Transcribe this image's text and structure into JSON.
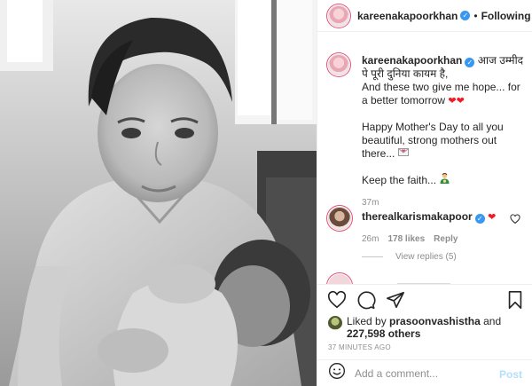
{
  "post": {
    "username": "kareenakapoorkhan",
    "follow_status": "Following",
    "header_separator": "•",
    "verified_icon": "verified-badge-icon"
  },
  "caption": {
    "username": "kareenakapoorkhan",
    "line1": "आज उम्मीद पे पूरी दुनिया कायम है,",
    "line2": "And these two give me hope... for a better tomorrow",
    "line3": "Happy Mother's Day to all you beautiful, strong mothers out there...",
    "line4": "Keep the faith...",
    "time": "37m"
  },
  "comment": {
    "username": "therealkarismakapoor",
    "time": "26m",
    "likes": "178 likes",
    "reply": "Reply",
    "view_replies": "View replies (5)"
  },
  "actions": {
    "icons": [
      "heart-icon",
      "comment-icon",
      "share-icon",
      "bookmark-icon"
    ]
  },
  "likes": {
    "prefix": "Liked by",
    "user": "prasoonvashistha",
    "and": "and",
    "count": "227,598 others"
  },
  "posted": "37 MINUTES AGO",
  "add_comment": {
    "placeholder": "Add a comment...",
    "post_label": "Post"
  },
  "colors": {
    "verified": "#3897f0",
    "heart": "#ed1c24",
    "muted": "#8e8e8e",
    "post_disabled": "#b2dffc"
  }
}
